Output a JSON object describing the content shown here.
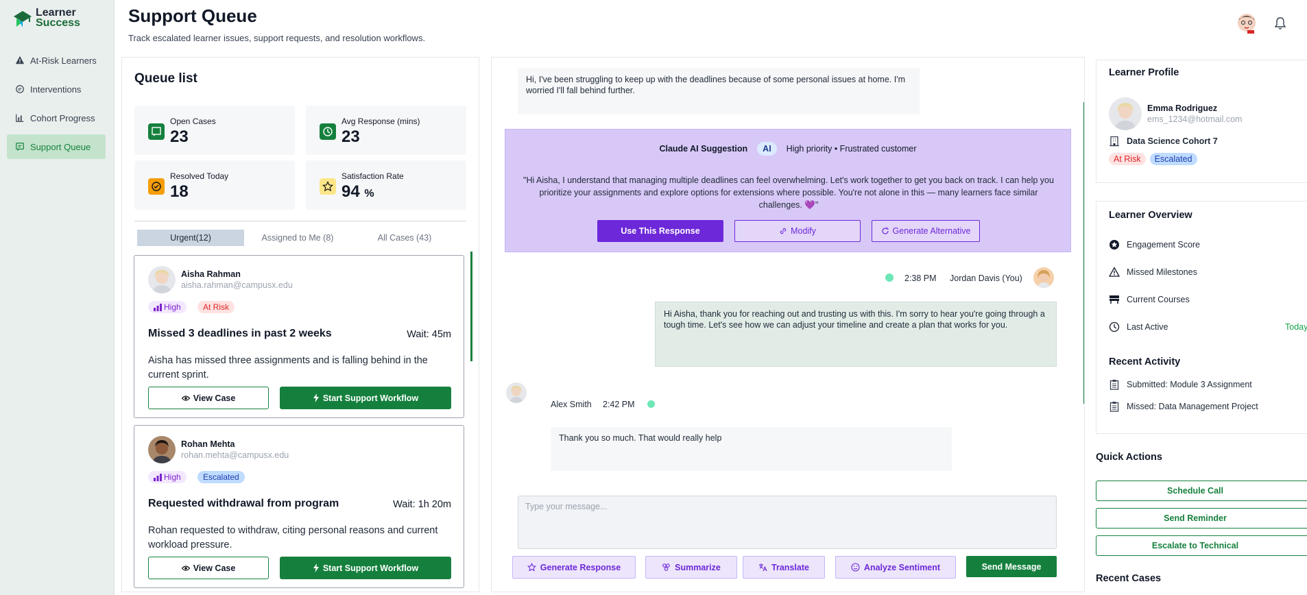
{
  "app": {
    "logo_line1": "Learner",
    "logo_line2": "Success"
  },
  "sidebar": {
    "items": [
      {
        "label": "At-Risk Learners",
        "icon": "warning-icon"
      },
      {
        "label": "Interventions",
        "icon": "chat-bubble-icon"
      },
      {
        "label": "Cohort Progress",
        "icon": "bar-chart-icon"
      },
      {
        "label": "Support Queue",
        "icon": "message-square-icon",
        "active": true
      }
    ]
  },
  "header": {
    "title": "Support Queue",
    "subtitle": "Track escalated learner issues, support requests, and resolution workflows."
  },
  "queue": {
    "title": "Queue list",
    "stats": [
      {
        "label": "Open Cases",
        "value": "23",
        "unit": "",
        "icon": "chat-square-icon",
        "color": "#15803d"
      },
      {
        "label": "Avg Response (mins)",
        "value": "23",
        "unit": "",
        "icon": "clock-icon",
        "color": "#15803d"
      },
      {
        "label": "Resolved Today",
        "value": "18",
        "unit": "",
        "icon": "check-circle-icon",
        "color": "#f59e0b"
      },
      {
        "label": "Satisfaction Rate",
        "value": "94",
        "unit": "%",
        "icon": "star-icon",
        "color": "#fde68a"
      }
    ],
    "tabs": [
      "Urgent(12)",
      "Assigned to Me (8)",
      "All Cases (43)"
    ],
    "cards": [
      {
        "name": "Aisha Rahman",
        "email": "aisha.rahman@campusx.edu",
        "priority": "High",
        "status": "At Risk",
        "title": "Missed 3 deadlines in past 2 weeks",
        "wait": "Wait: 45m",
        "description": "Aisha has missed three assignments and is falling behind in the current sprint.",
        "view_label": "View Case",
        "start_label": "Start Support Workflow"
      },
      {
        "name": "Rohan Mehta",
        "email": "rohan.mehta@campusx.edu",
        "priority": "High",
        "status": "Escalated",
        "title": "Requested withdrawal from program",
        "wait": "Wait: 1h 20m",
        "description": "Rohan requested to withdraw, citing personal reasons and current workload pressure.",
        "view_label": "View Case",
        "start_label": "Start Support Workflow"
      }
    ]
  },
  "chat": {
    "incoming_1": "Hi, I've been struggling to keep up with the deadlines because of some personal issues at home. I'm worried I'll fall behind further.",
    "ai": {
      "title": "Claude AI Suggestion",
      "pill": "AI",
      "tag": "High priority • Frustrated customer",
      "text": "\"Hi Aisha, I understand that managing multiple deadlines can feel overwhelming. Let's work together to get you back on track. I can help you prioritize your assignments and explore options for extensions where possible. You're not alone in this — many learners face similar challenges. 💜\"",
      "use_label": "Use This Response",
      "modify_label": "Modify",
      "alt_label": "Generate Alternative"
    },
    "outgoing": {
      "time": "2:38 PM",
      "author": "Jordan Davis (You)",
      "text": "Hi Aisha, thank you for reaching out and trusting us with this. I'm sorry to hear you're going through a tough time. Let's see how we can adjust your timeline and create a plan that works for you."
    },
    "incoming_2": {
      "author": "Alex Smith",
      "time": "2:42 PM",
      "text": "Thank you so much. That would really help"
    },
    "input_placeholder": "Type your message...",
    "tools": [
      "Generate Response",
      "Summarize",
      "Translate",
      "Analyze Sentiment"
    ],
    "send_label": "Send Message"
  },
  "profile": {
    "title": "Learner Profile",
    "name": "Emma Rodriguez",
    "email": "ems_1234@hotmail.com",
    "cohort": "Data Science Cohort 7",
    "badges": [
      "At Risk",
      "Escalated"
    ]
  },
  "overview": {
    "title": "Learner Overview",
    "items": [
      {
        "label": "Engagement Score",
        "value": ""
      },
      {
        "label": "Missed Milestones",
        "value": ""
      },
      {
        "label": "Current Courses",
        "value": ""
      },
      {
        "label": "Last Active",
        "value": "Today"
      }
    ],
    "recent_title": "Recent Activity",
    "recent": [
      "Submitted: Module 3 Assignment",
      "Missed: Data Management Project"
    ]
  },
  "quick_actions": {
    "title": "Quick Actions",
    "buttons": [
      "Schedule Call",
      "Send Reminder",
      "Escalate to Technical"
    ]
  },
  "recent_cases_title": "Recent Cases"
}
